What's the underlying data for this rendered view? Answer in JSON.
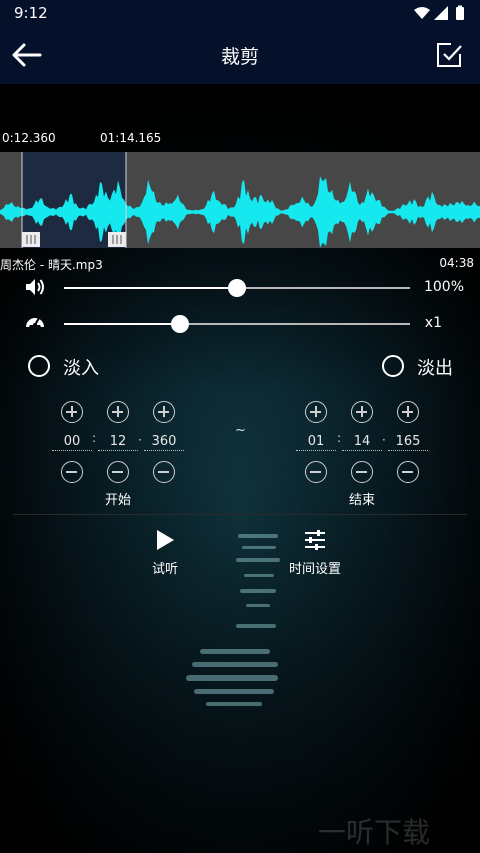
{
  "status": {
    "time": "9:12"
  },
  "app_bar": {
    "title": "裁剪"
  },
  "waveform": {
    "start_marker": "0:12.360",
    "end_marker": "01:14.165",
    "file_name": "周杰伦 - 晴天.mp3",
    "duration": "04:38",
    "wave_color": "#15e8ee",
    "selection_color": "#1e2a3f"
  },
  "volume": {
    "value_label": "100%",
    "level": 0.5
  },
  "speed": {
    "value_label": "x1",
    "level": 0.335
  },
  "fade": {
    "fade_in_label": "淡入",
    "fade_out_label": "淡出"
  },
  "start_time": {
    "minutes": "00",
    "seconds": "12",
    "millis": "360",
    "label": "开始"
  },
  "end_time": {
    "minutes": "01",
    "seconds": "14",
    "millis": "165",
    "label": "结束"
  },
  "range_separator": "~",
  "time_separators": {
    "colon": ":",
    "dot": "·"
  },
  "actions": {
    "play_label": "试听",
    "time_settings_label": "时间设置"
  },
  "watermark": "一听下载"
}
